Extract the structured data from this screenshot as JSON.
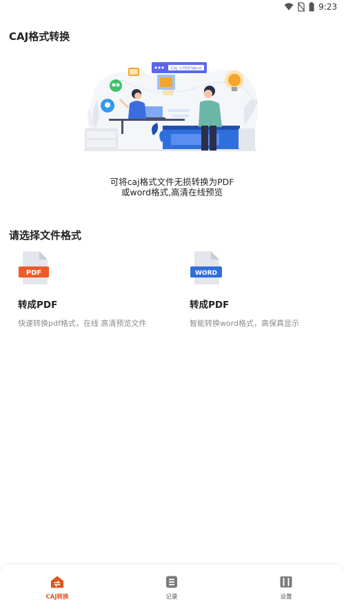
{
  "status_bar": {
    "time": "9:23"
  },
  "page": {
    "title": "CAJ格式转换"
  },
  "hero": {
    "window_label": "CAJ → PDF/Word"
  },
  "intro": {
    "line1": "可将caj格式文件无损转换为PDF",
    "line2": "或word格式,高清在线预览"
  },
  "section": {
    "title": "请选择文件格式"
  },
  "options": [
    {
      "badge": "PDF",
      "title": "转成PDF",
      "desc": "快速转换pdf格式，在线 高清预览文件",
      "icon": "pdf-file-icon",
      "color": "#f05a28"
    },
    {
      "badge": "WORD",
      "title": "转成PDF",
      "desc": "智能转换word格式，高保真显示",
      "icon": "word-file-icon",
      "color": "#2f6fdc"
    }
  ],
  "nav": [
    {
      "label": "CAJ转换",
      "icon": "home-convert-icon",
      "active": true
    },
    {
      "label": "记录",
      "icon": "records-icon",
      "active": false
    },
    {
      "label": "设置",
      "icon": "settings-icon",
      "active": false
    }
  ],
  "colors": {
    "accent": "#e0521c",
    "pdf": "#f05a28",
    "word": "#2f6fdc",
    "muted_text": "#8a8a8a"
  }
}
